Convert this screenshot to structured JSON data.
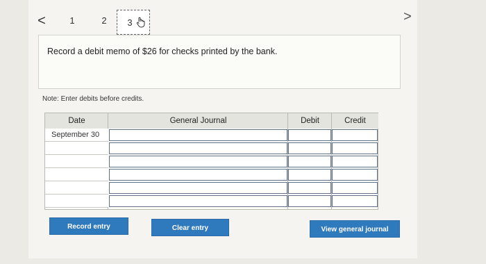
{
  "nav": {
    "prev_symbol": "<",
    "next_symbol": ">",
    "steps": [
      "1",
      "2",
      "3"
    ],
    "active_step": "3"
  },
  "question": {
    "text": "Record a debit memo of $26 for checks printed by the bank."
  },
  "note": "Note: Enter debits before credits.",
  "journal": {
    "headers": {
      "date": "Date",
      "general_journal": "General Journal",
      "debit": "Debit",
      "credit": "Credit"
    },
    "rows": [
      {
        "date": "September 30",
        "account": "",
        "debit": "",
        "credit": ""
      },
      {
        "date": "",
        "account": "",
        "debit": "",
        "credit": ""
      },
      {
        "date": "",
        "account": "",
        "debit": "",
        "credit": ""
      },
      {
        "date": "",
        "account": "",
        "debit": "",
        "credit": ""
      },
      {
        "date": "",
        "account": "",
        "debit": "",
        "credit": ""
      },
      {
        "date": "",
        "account": "",
        "debit": "",
        "credit": ""
      }
    ]
  },
  "buttons": {
    "record": "Record entry",
    "clear": "Clear entry",
    "view": "View general journal"
  },
  "colors": {
    "button_blue": "#2f79bd",
    "input_border": "#5e6f86",
    "header_bg": "#e3e4de"
  }
}
